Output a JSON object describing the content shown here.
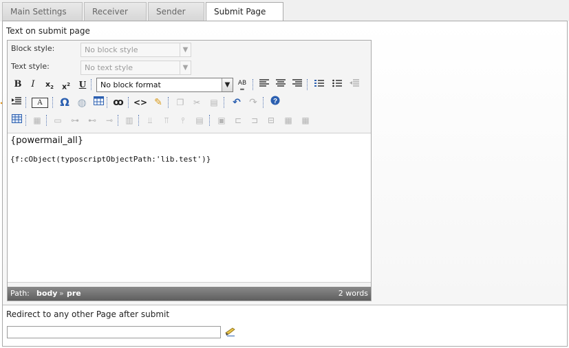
{
  "tabs": [
    {
      "label": "Main Settings"
    },
    {
      "label": "Receiver"
    },
    {
      "label": "Sender"
    },
    {
      "label": "Submit Page",
      "active": true
    }
  ],
  "submit_text": {
    "label": "Text on submit page",
    "block_style": {
      "label": "Block style:",
      "value": "No block style"
    },
    "text_style": {
      "label": "Text style:",
      "value": "No text style"
    },
    "format_select": {
      "value": "No block format"
    },
    "content": {
      "line1": "{powermail_all}",
      "line2": "{f:cObject(typoscriptObjectPath:'lib.test')}"
    },
    "status": {
      "path_label": "Path:",
      "path_body": "body",
      "path_sep": "»",
      "path_pre": "pre",
      "words": "2 words"
    }
  },
  "redirect": {
    "label": "Redirect to any other Page after submit",
    "value": ""
  },
  "colors": {
    "accent_blue": "#2b5fb0",
    "status_bar": "#6e6e6e"
  }
}
